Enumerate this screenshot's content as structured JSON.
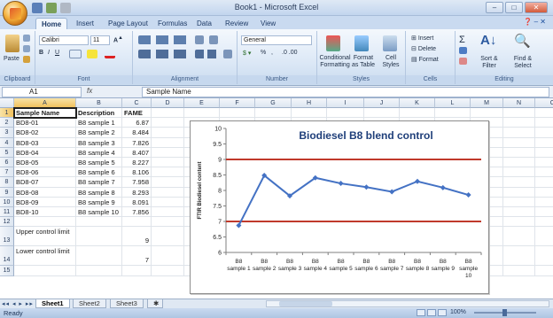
{
  "window": {
    "title": "Book1 - Microsoft Excel"
  },
  "ribbon": {
    "tabs": [
      "Home",
      "Insert",
      "Page Layout",
      "Formulas",
      "Data",
      "Review",
      "View"
    ],
    "font_name": "Calibri",
    "font_size": "11",
    "number_format": "General",
    "groups": [
      "Clipboard",
      "Font",
      "Alignment",
      "Number",
      "Styles",
      "Cells",
      "Editing"
    ],
    "buttons": {
      "paste": "Paste",
      "conditional_formatting": "Conditional Formatting",
      "format_as_table": "Format as Table",
      "cell_styles": "Cell Styles",
      "insert": "Insert",
      "delete": "Delete",
      "format": "Format",
      "sort_filter": "Sort & Filter",
      "find_select": "Find & Select"
    }
  },
  "formula_bar": {
    "name_box": "A1",
    "fx": "fx",
    "content": "Sample Name"
  },
  "columns": [
    "A",
    "B",
    "C",
    "D",
    "E",
    "F",
    "G",
    "H",
    "I",
    "J",
    "K",
    "L",
    "M",
    "N",
    "O"
  ],
  "rows": [
    {
      "n": "1",
      "a": "Sample Name",
      "b": "Description",
      "c": "FAME",
      "header": true
    },
    {
      "n": "2",
      "a": "BD8-01",
      "b": "B8 sample 1",
      "c": "6.87"
    },
    {
      "n": "3",
      "a": "BD8-02",
      "b": "B8 sample 2",
      "c": "8.484"
    },
    {
      "n": "4",
      "a": "BD8-03",
      "b": "B8 sample 3",
      "c": "7.826"
    },
    {
      "n": "5",
      "a": "BD8-04",
      "b": "B8 sample 4",
      "c": "8.407"
    },
    {
      "n": "6",
      "a": "BD8-05",
      "b": "B8 sample 5",
      "c": "8.227"
    },
    {
      "n": "7",
      "a": "BD8-06",
      "b": "B8 sample 6",
      "c": "8.106"
    },
    {
      "n": "8",
      "a": "BD8-07",
      "b": "B8 sample 7",
      "c": "7.958"
    },
    {
      "n": "9",
      "a": "BD8-08",
      "b": "B8 sample 8",
      "c": "8.293"
    },
    {
      "n": "10",
      "a": "BD8-09",
      "b": "B8 sample 9",
      "c": "8.091"
    },
    {
      "n": "11",
      "a": "BD8-10",
      "b": "B8 sample 10",
      "c": "7.856"
    },
    {
      "n": "12",
      "a": "",
      "b": "",
      "c": ""
    },
    {
      "n": "13",
      "a": "Upper control limit",
      "b": "",
      "c": "9",
      "tall": true
    },
    {
      "n": "14",
      "a": "Lower control limit",
      "b": "",
      "c": "7",
      "tall": true
    },
    {
      "n": "15",
      "a": "",
      "b": "",
      "c": ""
    }
  ],
  "sheets": [
    "Sheet1",
    "Sheet2",
    "Sheet3"
  ],
  "status": {
    "ready": "Ready",
    "zoom": "100%"
  },
  "colors": {
    "series": "#4472c4",
    "limit": "#c0392b",
    "title": "#1f3f7a"
  },
  "chart_data": {
    "type": "line",
    "title": "Biodiesel B8 blend control",
    "ylabel": "FTIR Biodiesel content",
    "xlabel": "",
    "ylim": [
      6,
      10
    ],
    "yticks": [
      6,
      6.5,
      7,
      7.5,
      8,
      8.5,
      9,
      9.5,
      10
    ],
    "categories": [
      "B8 sample 1",
      "B8 sample 2",
      "B8 sample 3",
      "B8 sample 4",
      "B8 sample 5",
      "B8 sample 6",
      "B8 sample 7",
      "B8 sample 8",
      "B8 sample 9",
      "B8 sample 10"
    ],
    "category_lines": [
      [
        "B8",
        "sample 1"
      ],
      [
        "B8",
        "sample 2"
      ],
      [
        "B8",
        "sample 3"
      ],
      [
        "B8",
        "sample 4"
      ],
      [
        "B8",
        "sample 5"
      ],
      [
        "B8",
        "sample 6"
      ],
      [
        "B8",
        "sample 7"
      ],
      [
        "B8",
        "sample 8"
      ],
      [
        "B8",
        "sample 9"
      ],
      [
        "B8",
        "sample",
        "10"
      ]
    ],
    "series": [
      {
        "values": [
          6.87,
          8.484,
          7.826,
          8.407,
          8.227,
          8.106,
          7.958,
          8.293,
          8.091,
          7.856
        ]
      }
    ],
    "reference_lines": [
      9,
      7
    ],
    "grid": false,
    "legend": "none"
  }
}
